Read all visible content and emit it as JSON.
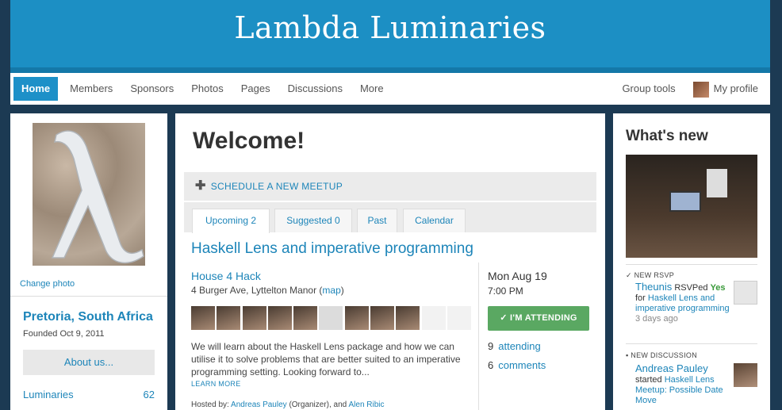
{
  "site": {
    "title": "Lambda Luminaries"
  },
  "nav": {
    "items": [
      "Home",
      "Members",
      "Sponsors",
      "Photos",
      "Pages",
      "Discussions",
      "More"
    ],
    "group_tools": "Group tools",
    "my_profile": "My profile"
  },
  "sidebar": {
    "change_photo": "Change photo",
    "location": "Pretoria, South Africa",
    "founded": "Founded Oct 9, 2011",
    "about": "About us...",
    "stats": [
      {
        "label": "Luminaries",
        "value": "62"
      }
    ]
  },
  "main": {
    "welcome": "Welcome!",
    "schedule": "SCHEDULE A NEW MEETUP",
    "tabs": [
      "Upcoming 2",
      "Suggested 0",
      "Past",
      "Calendar"
    ],
    "meetup": {
      "title": "Haskell Lens and imperative programming",
      "venue": "House 4 Hack",
      "address_pre": "4 Burger Ave, Lyttelton Manor (",
      "map": "map",
      "address_post": ")",
      "description": "We will learn about the Haskell Lens package and how we can utilise it to solve problems that are better suited to an imperative programming setting. Looking forward to...",
      "learn_more": "LEARN MORE",
      "hosted_pre": "Hosted by:",
      "host1": "Andreas Pauley",
      "host1_role": "(Organizer), and",
      "host2": "Alen Ribic",
      "date": "Mon Aug 19",
      "time": "7:00 PM",
      "attend_button": "✓ I'M ATTENDING",
      "attending_count": "9",
      "attending_label": "attending",
      "comments_count": "6",
      "comments_label": "comments"
    }
  },
  "whats_new": {
    "title": "What's new",
    "events": [
      {
        "type": "NEW RSVP",
        "name": "Theunis",
        "action": "RSVPed",
        "yes": "Yes",
        "for": "for",
        "link": "Haskell Lens and imperative programming",
        "time": "3 days ago"
      },
      {
        "type": "NEW DISCUSSION",
        "name": "Andreas Pauley",
        "action": "started",
        "link": "Haskell Lens Meetup: Possible Date Move"
      }
    ]
  }
}
